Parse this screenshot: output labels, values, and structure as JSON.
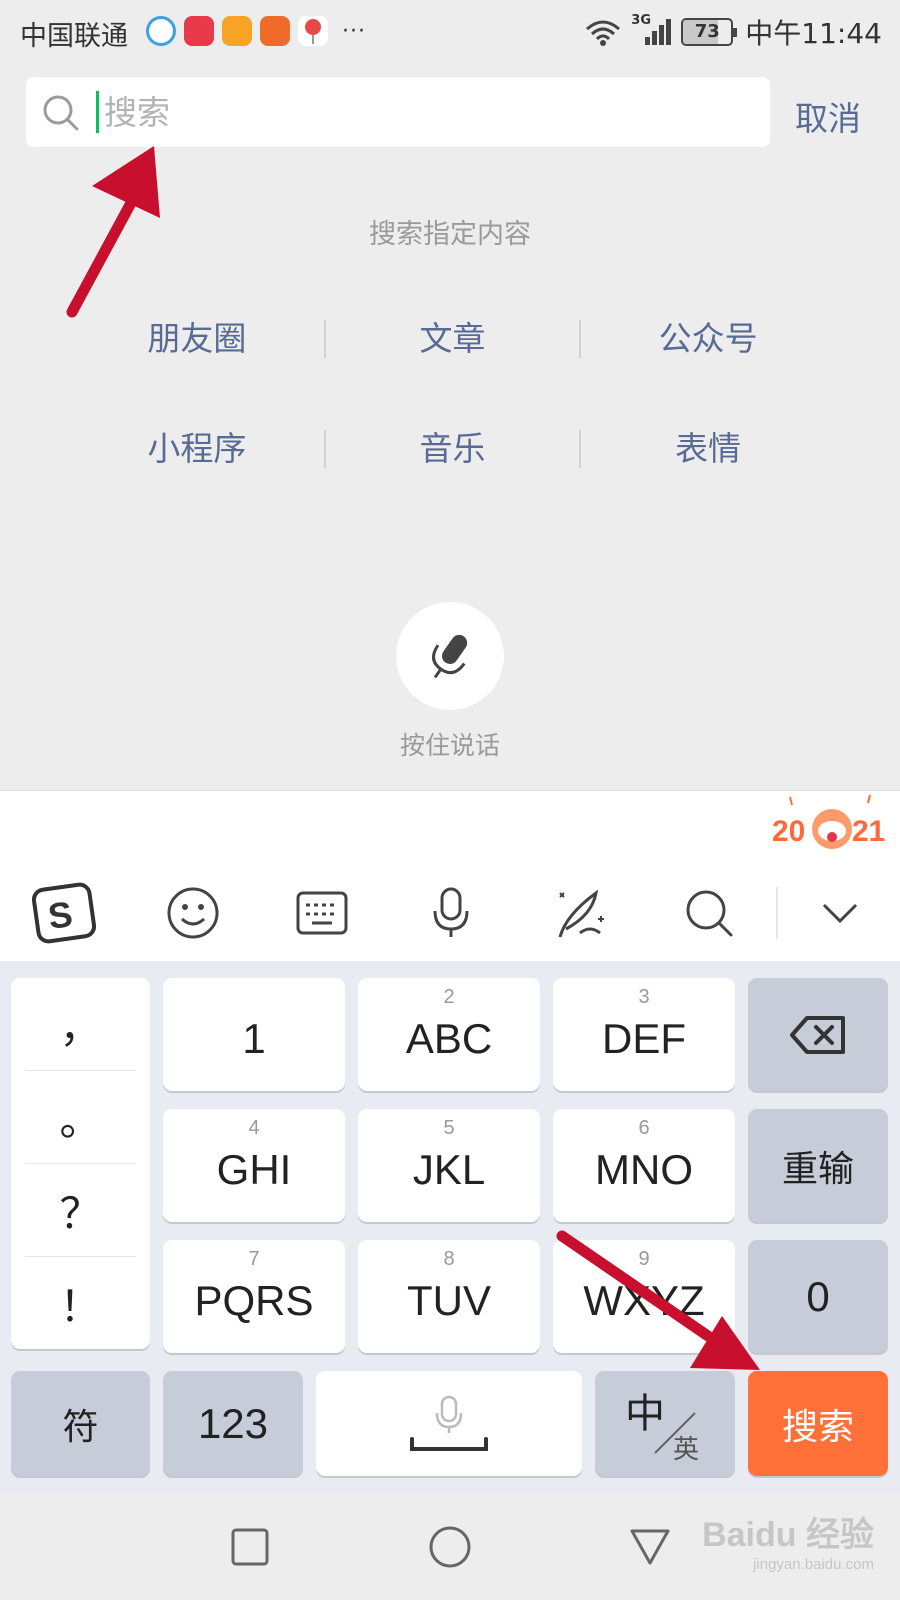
{
  "status_bar": {
    "carrier": "中国联通",
    "more": "···",
    "network": "3G",
    "battery": "73",
    "battery_level_percent": 73,
    "time": "中午11:44",
    "notification_icon_colors": [
      "#3aa0e8",
      "#e83a4a",
      "#f7a426",
      "#f06a2a",
      "#e94848"
    ]
  },
  "search": {
    "placeholder": "搜索",
    "value": "",
    "cancel_label": "取消",
    "caret_color": "#07c160"
  },
  "tip": "搜索指定内容",
  "categories": [
    [
      "朋友圈",
      "文章",
      "公众号"
    ],
    [
      "小程序",
      "音乐",
      "表情"
    ]
  ],
  "voice": {
    "label": "按住说话"
  },
  "keyboard": {
    "banner_text": "2021",
    "toolbar": [
      {
        "name": "sogou-logo-icon"
      },
      {
        "name": "emoji-icon"
      },
      {
        "name": "keyboard-layout-icon"
      },
      {
        "name": "voice-input-icon"
      },
      {
        "name": "handwriting-icon"
      },
      {
        "name": "search-icon"
      },
      {
        "name": "collapse-chevron-icon"
      }
    ],
    "punctuation": [
      "，",
      "。",
      "？",
      "！"
    ],
    "keys": {
      "row1": [
        {
          "num": "",
          "label": "1"
        },
        {
          "num": "2",
          "label": "ABC"
        },
        {
          "num": "3",
          "label": "DEF"
        }
      ],
      "row2": [
        {
          "num": "4",
          "label": "GHI"
        },
        {
          "num": "5",
          "label": "JKL"
        },
        {
          "num": "6",
          "label": "MNO"
        }
      ],
      "row3": [
        {
          "num": "7",
          "label": "PQRS"
        },
        {
          "num": "8",
          "label": "TUV"
        },
        {
          "num": "9",
          "label": "WXYZ"
        }
      ],
      "reset": "重输",
      "zero": "0",
      "symbols": "符",
      "numeric": "123",
      "lang_main": "中",
      "lang_sub": "英",
      "search": "搜索"
    },
    "accent_color": "#ff7139"
  },
  "watermark": {
    "main": "Baidu 经验",
    "sub": "jingyan.baidu.com"
  },
  "colors": {
    "link_blue": "#576b95",
    "annotation_arrow": "#c8102e"
  }
}
